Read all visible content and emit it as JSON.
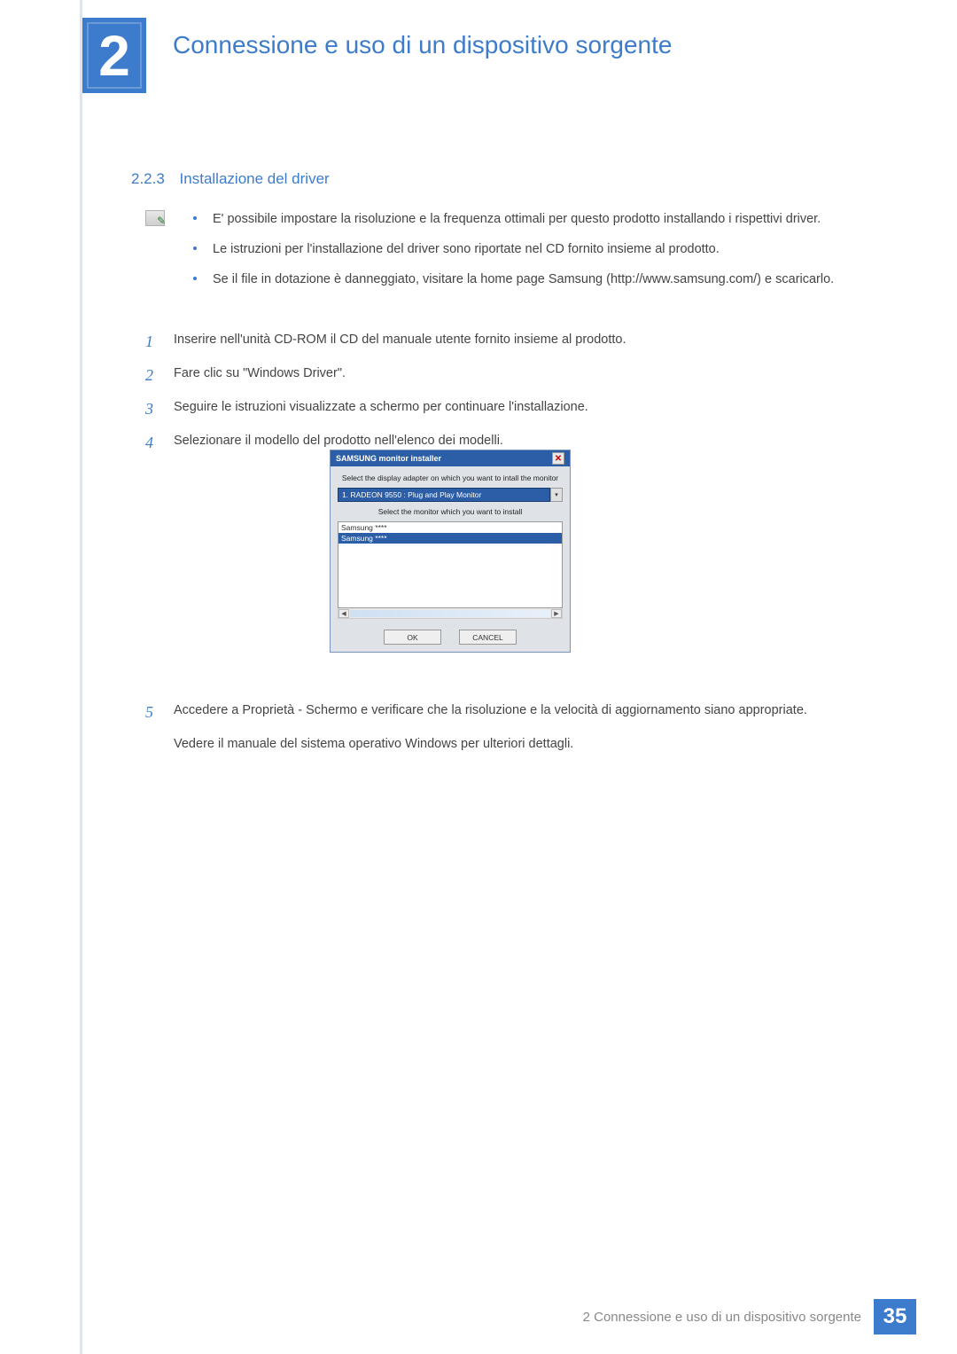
{
  "chapter": {
    "number": "2",
    "title": "Connessione e uso di un dispositivo sorgente"
  },
  "section": {
    "number": "2.2.3",
    "title": "Installazione del driver"
  },
  "note_bullets": [
    "E' possibile impostare la risoluzione e la frequenza ottimali per questo prodotto installando i rispettivi driver.",
    "Le istruzioni per l'installazione del driver sono riportate nel CD fornito insieme al prodotto.",
    "Se il file in dotazione è danneggiato, visitare la home page Samsung (http://www.samsung.com/) e scaricarlo."
  ],
  "steps_a": [
    {
      "n": "1",
      "text": "Inserire nell'unità CD-ROM il CD del manuale utente fornito insieme al prodotto."
    },
    {
      "n": "2",
      "text": "Fare clic su \"Windows Driver\"."
    },
    {
      "n": "3",
      "text": "Seguire le istruzioni visualizzate a schermo per continuare l'installazione."
    },
    {
      "n": "4",
      "text": "Selezionare il modello del prodotto nell'elenco dei modelli."
    }
  ],
  "installer": {
    "title": "SAMSUNG monitor installer",
    "close": "✕",
    "label1": "Select the display adapter on which you want to intall the monitor",
    "adapter": "1. RADEON 9550 : Plug and Play Monitor",
    "dropdown_arrow": "▾",
    "label2": "Select the monitor which you want to install",
    "list": [
      "Samsung ****",
      "Samsung ****"
    ],
    "scroll_left": "◀",
    "scroll_right": "▶",
    "ok": "OK",
    "cancel": "CANCEL"
  },
  "steps_b": {
    "n": "5",
    "text": "Accedere a Proprietà - Schermo e verificare che la risoluzione e la velocità di aggiornamento siano appropriate.",
    "extra": "Vedere il manuale del sistema operativo Windows per ulteriori dettagli."
  },
  "footer": {
    "text": "2 Connessione e uso di un dispositivo sorgente",
    "page": "35"
  }
}
